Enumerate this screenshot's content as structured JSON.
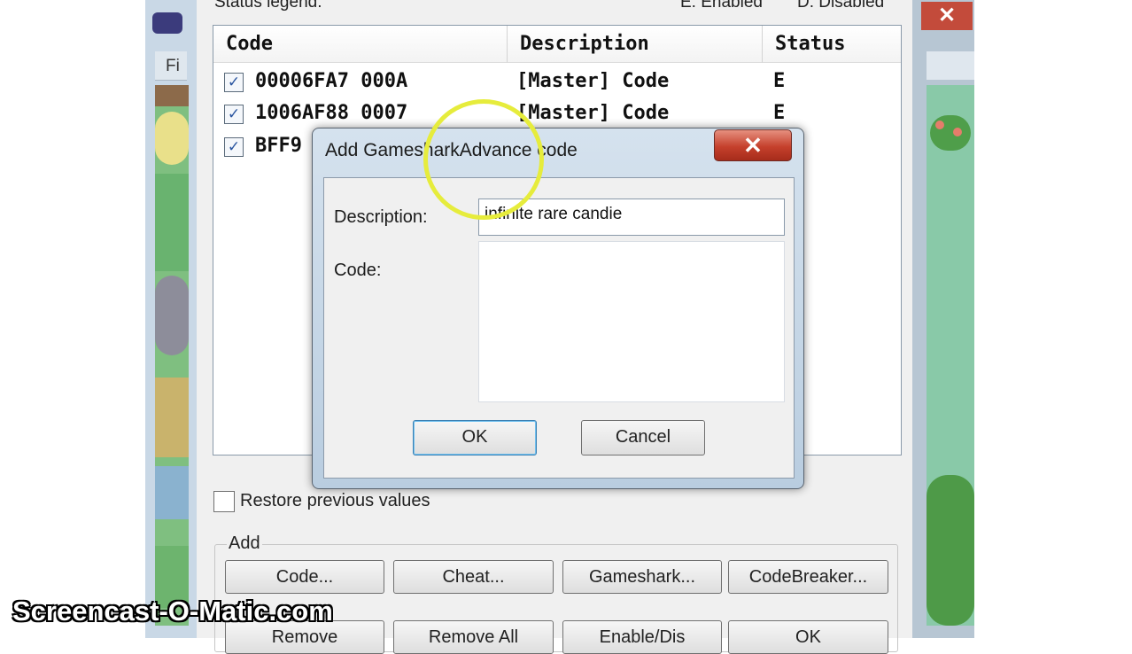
{
  "background_window": {
    "menu_label": "Fi",
    "close_glyph": "✕"
  },
  "cheat_list": {
    "legend_label": "Status legend:",
    "legend_enabled": "E: Enabled",
    "legend_disabled": "D: Disabled",
    "columns": [
      "Code",
      "Description",
      "Status"
    ],
    "rows": [
      {
        "checked": true,
        "code": "00006FA7 000A",
        "description": "[Master] Code",
        "status": "E"
      },
      {
        "checked": true,
        "code": "1006AF88 0007",
        "description": "[Master] Code",
        "status": "E"
      },
      {
        "checked": true,
        "code": "BFF9",
        "description": "",
        "status": ""
      }
    ],
    "restore_label": "Restore previous values",
    "add_group_label": "Add",
    "add_buttons": [
      "Code...",
      "Cheat...",
      "Gameshark...",
      "CodeBreaker..."
    ],
    "bottom_buttons": [
      "Remove",
      "Remove All",
      "Enable/Dis",
      "OK"
    ]
  },
  "add_dialog": {
    "title": "Add GamesharkAdvance code",
    "close_glyph": "✕",
    "description_label": "Description:",
    "description_value": "infinite rare candie",
    "code_label": "Code:",
    "code_value": "",
    "ok_label": "OK",
    "cancel_label": "Cancel"
  },
  "watermark": "Screencast-O-Matic.com",
  "colors": {
    "cursor_highlight": "#e6ec3c",
    "close_button": "#c5402c"
  }
}
